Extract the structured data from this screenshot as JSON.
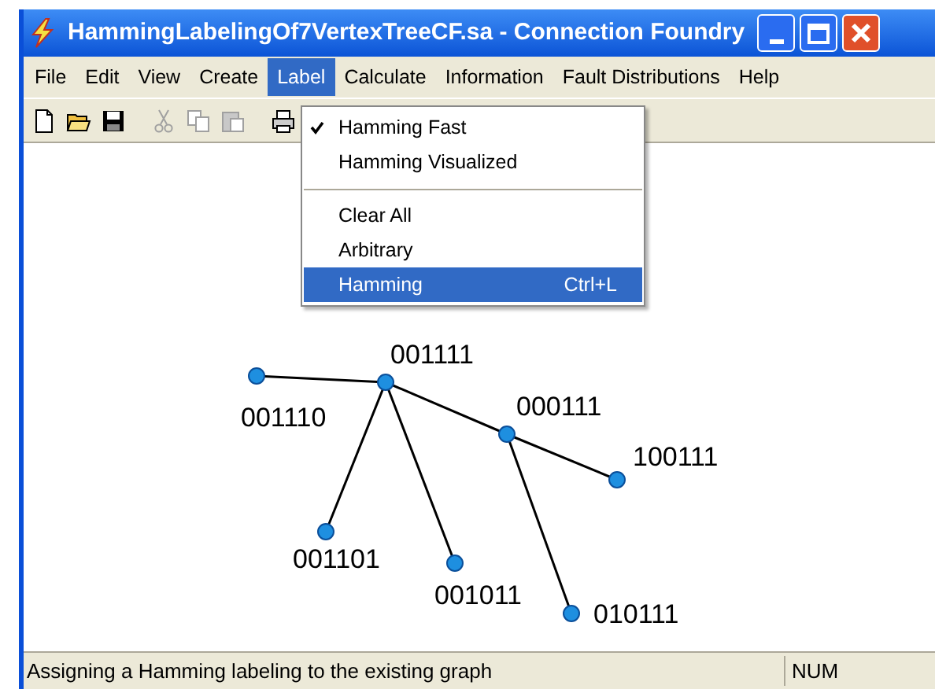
{
  "window": {
    "title": "HammingLabelingOf7VertexTreeCF.sa - Connection Foundry"
  },
  "menu": [
    {
      "label": "File",
      "selected": false
    },
    {
      "label": "Edit",
      "selected": false
    },
    {
      "label": "View",
      "selected": false
    },
    {
      "label": "Create",
      "selected": false
    },
    {
      "label": "Label",
      "selected": true
    },
    {
      "label": "Calculate",
      "selected": false
    },
    {
      "label": "Information",
      "selected": false
    },
    {
      "label": "Fault Distributions",
      "selected": false
    },
    {
      "label": "Help",
      "selected": false
    }
  ],
  "toolbar": [
    {
      "kind": "new",
      "disabled": false
    },
    {
      "kind": "open",
      "disabled": false
    },
    {
      "kind": "save",
      "disabled": false
    },
    {
      "kind": "cut",
      "disabled": true
    },
    {
      "kind": "copy",
      "disabled": true
    },
    {
      "kind": "paste",
      "disabled": true
    },
    {
      "kind": "print",
      "disabled": false
    }
  ],
  "dropdown": [
    {
      "kind": "item",
      "label": "Hamming Fast",
      "checked": true,
      "selected": false
    },
    {
      "kind": "item",
      "label": "Hamming Visualized",
      "checked": false,
      "selected": false
    },
    {
      "kind": "separator"
    },
    {
      "kind": "item",
      "label": "Clear All",
      "checked": false,
      "selected": false
    },
    {
      "kind": "item",
      "label": "Arbitrary",
      "checked": false,
      "selected": false
    },
    {
      "kind": "item",
      "label": "Hamming",
      "shortcut": "Ctrl+L",
      "checked": false,
      "selected": true
    }
  ],
  "graph": {
    "nodes": [
      {
        "label": "001110"
      },
      {
        "label": "001111"
      },
      {
        "label": "000111"
      },
      {
        "label": "100111"
      },
      {
        "label": "001101"
      },
      {
        "label": "001011"
      },
      {
        "label": "010111"
      }
    ]
  },
  "status_bar": {
    "message": "Assigning a Hamming labeling to the existing graph",
    "indicator": "NUM"
  }
}
